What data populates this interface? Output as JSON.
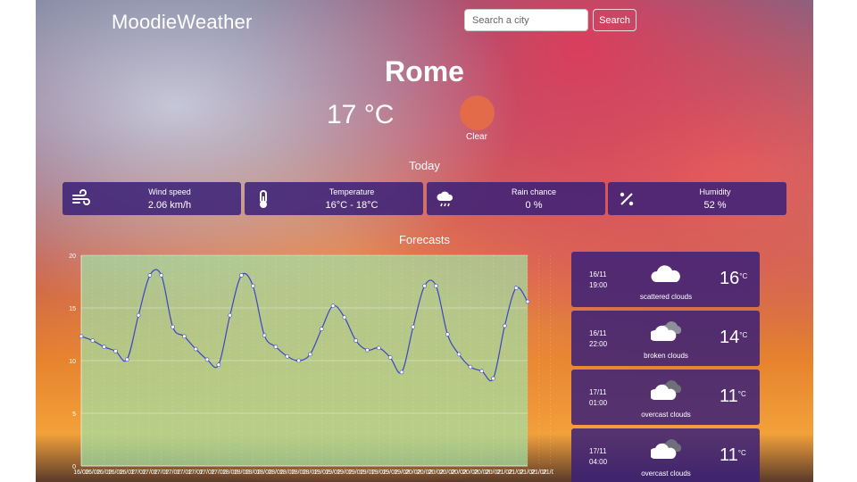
{
  "app": {
    "brand": "MoodieWeather"
  },
  "search": {
    "placeholder": "Search a city",
    "button": "Search"
  },
  "current": {
    "city": "Rome",
    "temperature": "17 °C",
    "condition": "Clear",
    "condition_color": "#e36b4a"
  },
  "today": {
    "title": "Today",
    "stats": [
      {
        "icon": "wind-icon",
        "label": "Wind speed",
        "value": "2.06 km/h"
      },
      {
        "icon": "thermometer-icon",
        "label": "Temperature",
        "value": "16°C - 18°C"
      },
      {
        "icon": "rain-cloud-icon",
        "label": "Rain chance",
        "value": "0 %"
      },
      {
        "icon": "percent-icon",
        "label": "Humidity",
        "value": "52 %"
      }
    ]
  },
  "forecasts": {
    "title": "Forecasts",
    "cards": [
      {
        "date": "16/11",
        "time": "19:00",
        "icon": "cloud-icon",
        "description": "scattered clouds",
        "temp": "16",
        "unit": "°C"
      },
      {
        "date": "16/11",
        "time": "22:00",
        "icon": "broken-clouds-icon",
        "description": "broken clouds",
        "temp": "14",
        "unit": "°C"
      },
      {
        "date": "17/11",
        "time": "01:00",
        "icon": "overcast-clouds-icon",
        "description": "overcast clouds",
        "temp": "11",
        "unit": "°C"
      },
      {
        "date": "17/11",
        "time": "04:00",
        "icon": "overcast-clouds-icon",
        "description": "overcast clouds",
        "temp": "11",
        "unit": "°C"
      }
    ]
  },
  "chart_data": {
    "type": "line",
    "ylim": [
      0,
      20
    ],
    "yticks": [
      0,
      5,
      10,
      15,
      20
    ],
    "grid": true,
    "line_color": "#3b45c8",
    "fill_color": "#9fe3a6",
    "x": [
      "16/02",
      "16/02",
      "16/02",
      "16/02",
      "16/02",
      "17/02",
      "17/02",
      "17/02",
      "17/02",
      "17/02",
      "17/02",
      "17/02",
      "17/02",
      "18/02",
      "18/02",
      "18/02",
      "18/02",
      "18/02",
      "18/02",
      "18/02",
      "18/02",
      "19/02",
      "19/02",
      "19/02",
      "19/02",
      "19/02",
      "19/02",
      "19/02",
      "19/02",
      "20/02",
      "20/02",
      "20/02",
      "20/02",
      "20/02",
      "20/02",
      "20/02",
      "20/02",
      "21/02",
      "21/02",
      "21/02",
      "21/02",
      "21/02"
    ],
    "values": [
      12.3,
      11.9,
      11.3,
      10.9,
      10.1,
      14.3,
      18.1,
      18.1,
      13.2,
      12.3,
      11.1,
      10.1,
      9.6,
      14.3,
      18.1,
      17.1,
      12.4,
      11.3,
      10.4,
      10.0,
      10.6,
      13.0,
      15.2,
      14.1,
      11.9,
      11.0,
      11.2,
      10.3,
      8.9,
      13.2,
      17.1,
      17.1,
      12.5,
      10.6,
      9.4,
      9.0,
      8.3,
      13.3,
      16.9,
      15.6
    ]
  }
}
